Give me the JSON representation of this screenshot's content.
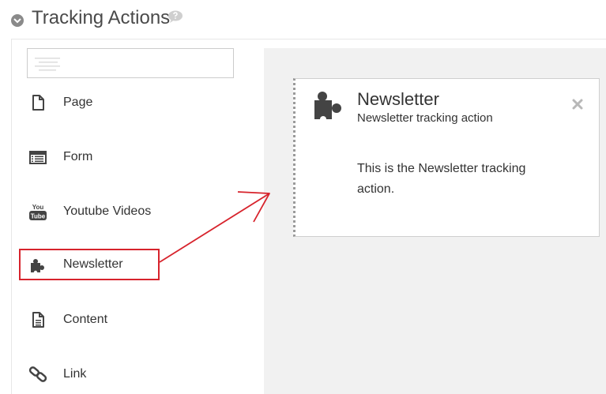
{
  "header": {
    "title": "Tracking Actions",
    "collapse_icon": "chevron-down-icon",
    "help_icon": "speech-bubble-icon"
  },
  "search": {
    "value": "",
    "icon": "text-lines-icon"
  },
  "sidebar": {
    "items": [
      {
        "label": "Page",
        "icon": "page-icon"
      },
      {
        "label": "Form",
        "icon": "form-icon"
      },
      {
        "label": "Youtube Videos",
        "icon": "youtube-icon"
      },
      {
        "label": "Newsletter",
        "icon": "puzzle-icon",
        "highlighted": true
      },
      {
        "label": "Content",
        "icon": "document-icon"
      },
      {
        "label": "Link",
        "icon": "link-icon"
      }
    ]
  },
  "card": {
    "icon": "puzzle-icon",
    "title": "Newsletter",
    "subtitle": "Newsletter tracking action",
    "body": "This is the Newsletter tracking action.",
    "close_icon": "close-icon"
  },
  "colors": {
    "highlight": "#d7232c",
    "icon": "#444444",
    "canvas_background": "#f1f1f1",
    "title": "#4a4a4a"
  }
}
